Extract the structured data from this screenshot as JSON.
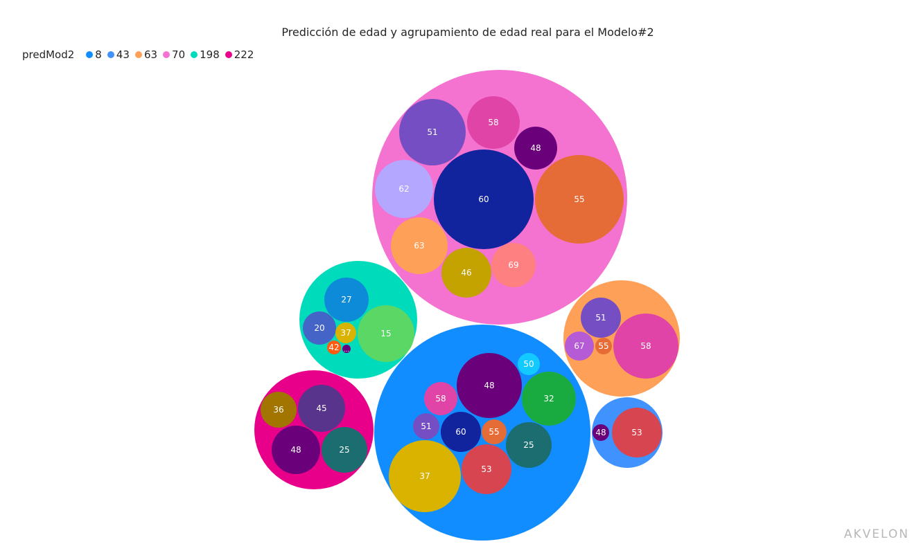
{
  "chart_data": {
    "type": "packed-bubble",
    "title": "Predicción de edad y agrupamiento de edad real para el Modelo#2",
    "legend_title": "predMod2",
    "legend_position": "top-left",
    "groups": [
      {
        "name": "8",
        "color": "#118DFF",
        "children": [
          {
            "label": "48",
            "color": "#6B007B"
          },
          {
            "label": "50",
            "color": "#12CAFF"
          },
          {
            "label": "32",
            "color": "#1AAB40"
          },
          {
            "label": "58",
            "color": "#E044A7"
          },
          {
            "label": "51",
            "color": "#744EC2"
          },
          {
            "label": "60",
            "color": "#12239E"
          },
          {
            "label": "55",
            "color": "#E66C37"
          },
          {
            "label": "25",
            "color": "#1B6D6F"
          },
          {
            "label": "37",
            "color": "#D9B300"
          },
          {
            "label": "53",
            "color": "#D64550"
          }
        ]
      },
      {
        "name": "43",
        "color": "#4092FF",
        "children": [
          {
            "label": "48",
            "color": "#6B007B"
          },
          {
            "label": "53",
            "color": "#D64550"
          }
        ]
      },
      {
        "name": "63",
        "color": "#FFA058",
        "children": [
          {
            "label": "51",
            "color": "#744EC2"
          },
          {
            "label": "67",
            "color": "#B55BD5"
          },
          {
            "label": "55",
            "color": "#E66C37"
          },
          {
            "label": "58",
            "color": "#E044A7"
          }
        ]
      },
      {
        "name": "70",
        "color": "#F472D0",
        "children": [
          {
            "label": "51",
            "color": "#744EC2"
          },
          {
            "label": "58",
            "color": "#E044A7"
          },
          {
            "label": "48",
            "color": "#6B007B"
          },
          {
            "label": "62",
            "color": "#B4A7FF"
          },
          {
            "label": "60",
            "color": "#12239E"
          },
          {
            "label": "55",
            "color": "#E66C37"
          },
          {
            "label": "63",
            "color": "#FFA058"
          },
          {
            "label": "46",
            "color": "#C4A200"
          },
          {
            "label": "69",
            "color": "#FF8080"
          }
        ]
      },
      {
        "name": "198",
        "color": "#00DBBC",
        "children": [
          {
            "label": "27",
            "color": "#0D8BD8"
          },
          {
            "label": "20",
            "color": "#4465C7"
          },
          {
            "label": "37",
            "color": "#D9B300"
          },
          {
            "label": "15",
            "color": "#5AD765"
          },
          {
            "label": "42",
            "color": "#FF5A0E"
          },
          {
            "label": "...",
            "color": "#6B007B"
          }
        ]
      },
      {
        "name": "222",
        "color": "#E8008A",
        "children": [
          {
            "label": "36",
            "color": "#A27400"
          },
          {
            "label": "45",
            "color": "#58348D"
          },
          {
            "label": "48",
            "color": "#6B007B"
          },
          {
            "label": "25",
            "color": "#1B6D6F"
          }
        ]
      }
    ]
  },
  "branding": {
    "logo_text": "AKVELON"
  }
}
